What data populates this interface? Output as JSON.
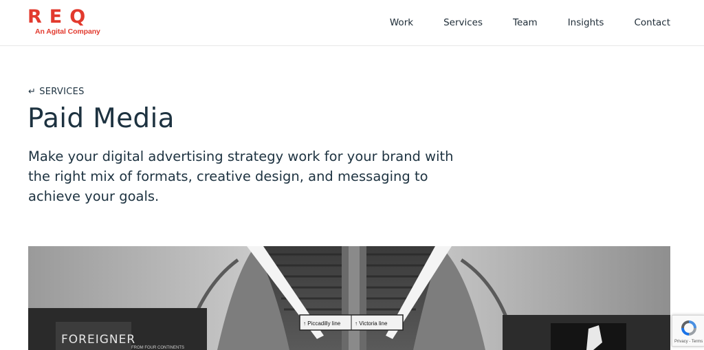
{
  "brand": {
    "logo_text": "REQ",
    "tagline": "An Agital Company",
    "color": "#e23a2e"
  },
  "nav": {
    "items": [
      {
        "label": "Work"
      },
      {
        "label": "Services"
      },
      {
        "label": "Team"
      },
      {
        "label": "Insights"
      },
      {
        "label": "Contact"
      }
    ]
  },
  "hero": {
    "breadcrumb_icon": "return-arrow-icon",
    "breadcrumb": "SERVICES",
    "title": "Paid Media",
    "lead": "Make your digital advertising strategy work for your brand with the right mix of formats, creative design, and messaging to achieve your goals."
  },
  "photo": {
    "sign_left": "↑ Piccadilly line",
    "sign_right": "↑ Victoria line",
    "poster_left": "FOREIGNER",
    "poster_left_sub": "FROM FOUR CONTINENTS"
  },
  "recaptcha": {
    "icon": "recaptcha-icon",
    "text": "Privacy - Terms"
  },
  "colors": {
    "text": "#1d3240",
    "accent": "#e23a2e"
  }
}
